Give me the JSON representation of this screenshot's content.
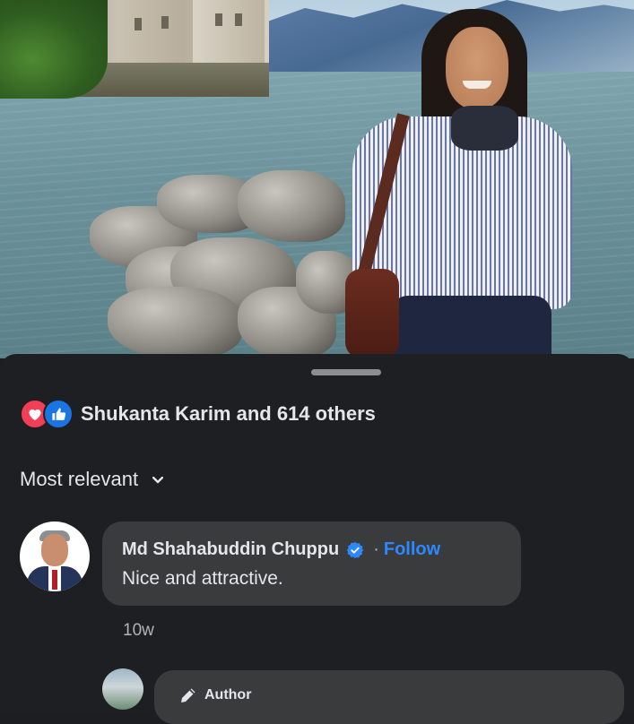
{
  "reactions": {
    "summary": "Shukanta Karim and 614 others",
    "icons": [
      "heart-reaction-icon",
      "like-reaction-icon"
    ]
  },
  "sort": {
    "label": "Most relevant"
  },
  "comment": {
    "author": "Md Shahabuddin Chuppu",
    "separator": "·",
    "follow_label": "Follow",
    "text": "Nice and attractive.",
    "time": "10w"
  },
  "reply": {
    "badge": "Author"
  },
  "colors": {
    "sheet_bg": "#1d1f22",
    "bubble_bg": "#3a3b3c",
    "link": "#2d88ff",
    "love": "#f33e58",
    "like": "#1b74e4"
  }
}
